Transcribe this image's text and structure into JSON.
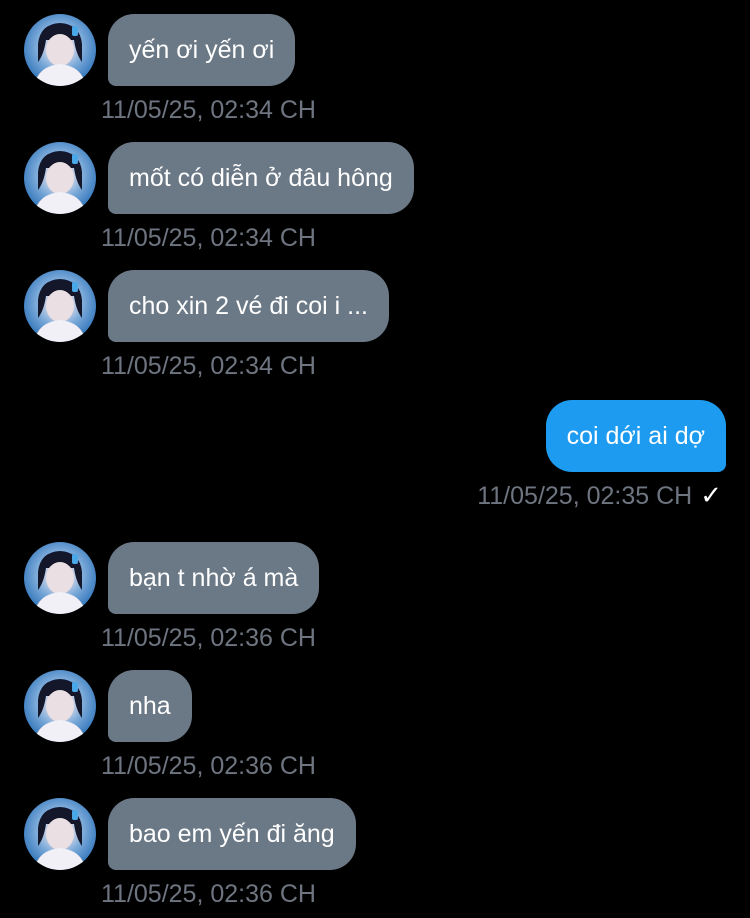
{
  "messages": [
    {
      "side": "in",
      "text": "yến ơi yến ơi",
      "time": "11/05/25, 02:34 CH"
    },
    {
      "side": "in",
      "text": "mốt có diễn ở đâu hông",
      "time": "11/05/25, 02:34 CH"
    },
    {
      "side": "in",
      "text": "cho xin 2 vé đi coi i ...",
      "time": "11/05/25, 02:34 CH"
    },
    {
      "side": "out",
      "text": "coi dới ai dợ",
      "time": "11/05/25, 02:35 CH",
      "status_icon": "checkmark-icon",
      "status_glyph": "✓"
    },
    {
      "side": "in",
      "text": "bạn t nhờ á mà",
      "time": "11/05/25, 02:36 CH"
    },
    {
      "side": "in",
      "text": "nha",
      "time": "11/05/25, 02:36 CH"
    },
    {
      "side": "in",
      "text": "bao em yến đi ăng",
      "time": "11/05/25, 02:36 CH"
    }
  ],
  "colors": {
    "background": "#000000",
    "incoming_bubble": "#6b7886",
    "outgoing_bubble": "#1d9bf0",
    "timestamp": "#6e7580",
    "text": "#ffffff"
  }
}
